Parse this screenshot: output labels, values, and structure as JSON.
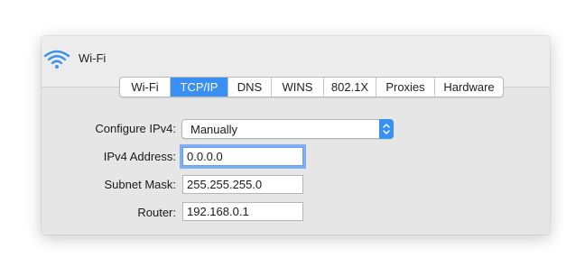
{
  "window": {
    "title": "Wi-Fi"
  },
  "tabs": [
    {
      "label": "Wi-Fi",
      "active": false
    },
    {
      "label": "TCP/IP",
      "active": true
    },
    {
      "label": "DNS",
      "active": false
    },
    {
      "label": "WINS",
      "active": false
    },
    {
      "label": "802.1X",
      "active": false
    },
    {
      "label": "Proxies",
      "active": false
    },
    {
      "label": "Hardware",
      "active": false
    }
  ],
  "form": {
    "configure_ipv4": {
      "label": "Configure IPv4:",
      "value": "Manually"
    },
    "ipv4_address": {
      "label": "IPv4 Address:",
      "value": "0.0.0.0"
    },
    "subnet_mask": {
      "label": "Subnet Mask:",
      "value": "255.255.255.0"
    },
    "router": {
      "label": "Router:",
      "value": "192.168.0.1"
    }
  },
  "colors": {
    "accent": "#3a8ff3",
    "focus_ring": "#7eaef4",
    "panel": "#e6e6e6"
  },
  "icons": {
    "title": "wifi-icon",
    "select": "chevron-updown-icon"
  }
}
